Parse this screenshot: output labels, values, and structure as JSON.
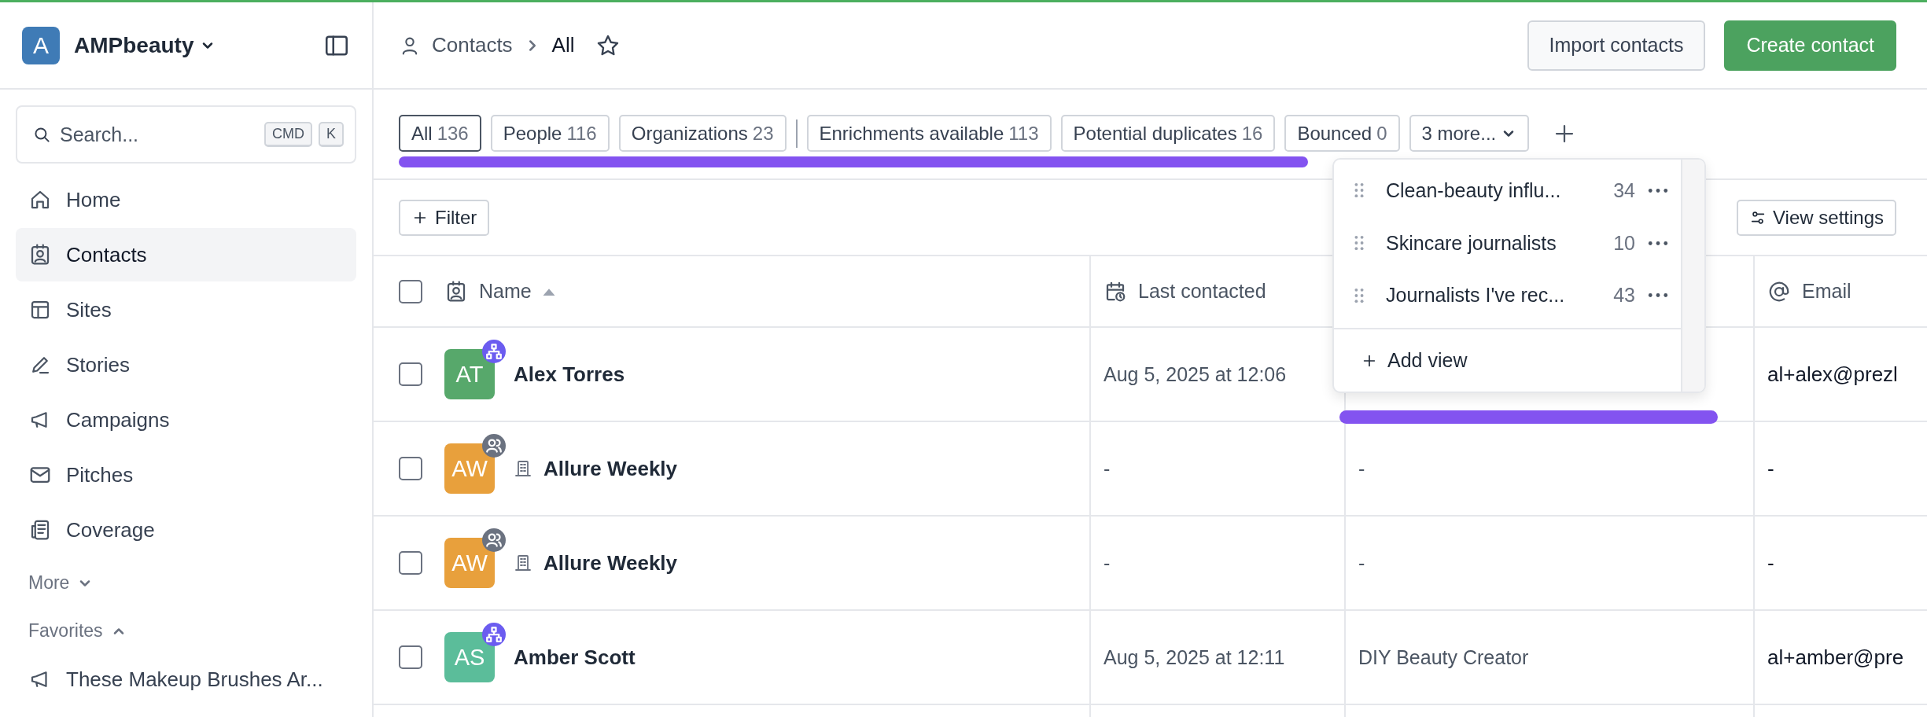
{
  "workspace": {
    "initial": "A",
    "name": "AMPbeauty"
  },
  "search": {
    "placeholder": "Search...",
    "keys": [
      "CMD",
      "K"
    ]
  },
  "nav": [
    {
      "label": "Home",
      "kind": "home",
      "selected": false
    },
    {
      "label": "Contacts",
      "kind": "contacts",
      "selected": true
    },
    {
      "label": "Sites",
      "kind": "sites",
      "selected": false
    },
    {
      "label": "Stories",
      "kind": "stories",
      "selected": false
    },
    {
      "label": "Campaigns",
      "kind": "campaigns",
      "selected": false
    },
    {
      "label": "Pitches",
      "kind": "pitches",
      "selected": false
    },
    {
      "label": "Coverage",
      "kind": "coverage",
      "selected": false
    }
  ],
  "more": {
    "label": "More",
    "expanded": false
  },
  "favorites": {
    "title": "Favorites",
    "expanded": true,
    "items": [
      {
        "label": "These Makeup Brushes Ar...",
        "kind": "campaigns"
      }
    ]
  },
  "breadcrumb": {
    "section": "Contacts",
    "current": "All",
    "starred": false
  },
  "actions": [
    {
      "label": "Import contacts",
      "kind": "secondary"
    },
    {
      "label": "Create contact",
      "kind": "primary"
    }
  ],
  "views": [
    {
      "label": "All",
      "count": "136",
      "selected": true,
      "divider_before": false
    },
    {
      "label": "People",
      "count": "116",
      "selected": false,
      "divider_before": false
    },
    {
      "label": "Organizations",
      "count": "23",
      "selected": false,
      "divider_before": false
    },
    {
      "label": "Enrichments available",
      "count": "113",
      "selected": false,
      "divider_before": true
    },
    {
      "label": "Potential duplicates",
      "count": "16",
      "selected": false,
      "divider_before": false
    },
    {
      "label": "Bounced",
      "count": "0",
      "selected": false,
      "divider_before": false
    }
  ],
  "more_views": {
    "label": "3 more...",
    "expanded": true,
    "items": [
      {
        "label": "Clean-beauty influ...",
        "count": "34"
      },
      {
        "label": "Skincare journalists",
        "count": "10"
      },
      {
        "label": "Journalists I've rec...",
        "count": "43"
      }
    ],
    "add": "Add view"
  },
  "filter": "Filter",
  "view_settings": "View settings",
  "table": {
    "select_all": {
      "checked": false
    },
    "columns": {
      "name": {
        "label": "Name",
        "sorted": true
      },
      "last_contacted": {
        "label": "Last contacted"
      },
      "email": {
        "label": "Email"
      }
    },
    "rows": [
      {
        "initials": "AT",
        "name": "Alex Torres",
        "color": "#57a86b",
        "kind": "person",
        "badge": {
          "kind": "network"
        },
        "checked": false,
        "last_contacted": "Aug 5, 2025 at 12:06",
        "email": "al+alex@prezl"
      },
      {
        "initials": "AW",
        "name": "Allure Weekly",
        "color": "#e8a03c",
        "kind": "organization",
        "badge": {
          "kind": "people"
        },
        "checked": false,
        "last_contacted": "-",
        "column_3": "-",
        "email": "-"
      },
      {
        "initials": "AW",
        "name": "Allure Weekly",
        "color": "#e8a03c",
        "kind": "organization",
        "badge": {
          "kind": "people"
        },
        "checked": false,
        "last_contacted": "-",
        "column_3": "-",
        "email": "-"
      },
      {
        "initials": "AS",
        "name": "Amber Scott",
        "color": "#5bbd9a",
        "kind": "person",
        "badge": {
          "kind": "network"
        },
        "checked": false,
        "last_contacted": "Aug 5, 2025 at 12:11",
        "column_3": "DIY Beauty Creator",
        "email": "al+amber@pre"
      }
    ]
  }
}
